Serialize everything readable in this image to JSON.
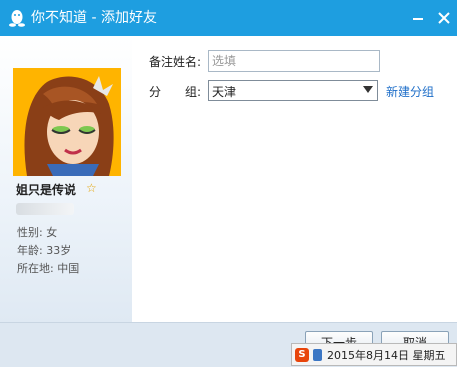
{
  "window": {
    "title": "你不知道 - 添加好友",
    "colors": {
      "titlebar": "#1e9ee0",
      "link": "#1e6ec8",
      "star": "#e4a300"
    }
  },
  "profile": {
    "nickname": "姐只是传说",
    "gender": "性别: 女",
    "age": "年龄: 33岁",
    "location": "所在地: 中国"
  },
  "form": {
    "remark_label": "备注姓名:",
    "remark_placeholder": "选填",
    "remark_value": "",
    "group_label": "分　　组:",
    "group_value": "天津",
    "new_group_link": "新建分组"
  },
  "buttons": {
    "next": "下一步",
    "cancel": "取消"
  },
  "ime": {
    "date_text": "2015年8月14日 星期五"
  }
}
